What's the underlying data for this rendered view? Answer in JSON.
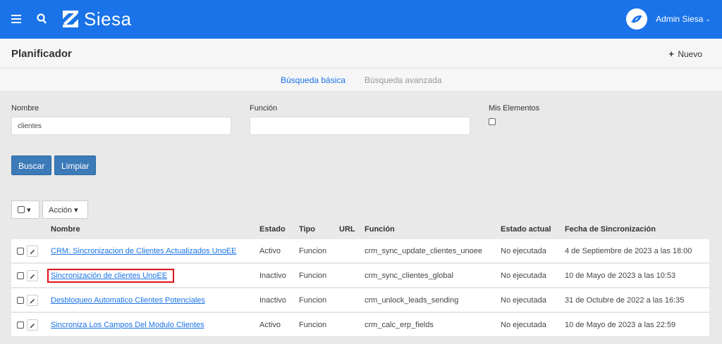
{
  "header": {
    "brand": "Siesa",
    "user_name": "Admin Siesa",
    "caret": "⌄"
  },
  "titlebar": {
    "title": "Planificador",
    "nuevo_icon": "+",
    "nuevo_label": "Nuevo"
  },
  "tabs": [
    {
      "label": "Búsqueda básica",
      "active": true
    },
    {
      "label": "Búsqueda avanzada",
      "active": false
    }
  ],
  "filters": {
    "nombre_label": "Nombre",
    "nombre_value": "clientes",
    "funcion_label": "Función",
    "funcion_value": "",
    "mis_elementos_label": "Mis Elementos",
    "buscar_label": "Buscar",
    "limpiar_label": "Limpiar"
  },
  "table": {
    "select_caret": "▾",
    "accion_label": "Acción",
    "headers": [
      "Nombre",
      "Estado",
      "Tipo",
      "URL",
      "Función",
      "Estado actual",
      "Fecha de Sincronización"
    ],
    "rows": [
      {
        "nombre": "CRM: Sincronizacion de Clientes Actualizados UnoEE",
        "estado": "Activo",
        "tipo": "Funcion",
        "url": "",
        "funcion": "crm_sync_update_clientes_unoee",
        "estado_actual": "No ejecutada",
        "fecha": "4 de Septiembre de 2023 a las 18:00"
      },
      {
        "nombre": "Sincronización de clientes UnoEE",
        "estado": "Inactivo",
        "tipo": "Funcion",
        "url": "",
        "funcion": "crm_sync_clientes_global",
        "estado_actual": "No ejecutada",
        "fecha": "10 de Mayo de 2023 a las 10:53"
      },
      {
        "nombre": "Desbloqueo Automatico Clientes Potenciales",
        "estado": "Inactivo",
        "tipo": "Funcion",
        "url": "",
        "funcion": "crm_unlock_leads_sending",
        "estado_actual": "No ejecutada",
        "fecha": "31 de Octubre de 2022 a las 16:35"
      },
      {
        "nombre": "Sincroniza Los Campos Del Modulo Clientes",
        "estado": "Activo",
        "tipo": "Funcion",
        "url": "",
        "funcion": "crm_calc_erp_fields",
        "estado_actual": "No ejecutada",
        "fecha": "10 de Mayo de 2023 a las 22:59"
      }
    ]
  },
  "colors": {
    "primary": "#1a73e8",
    "button": "#3c7ab8",
    "highlight": "#e0121b"
  }
}
